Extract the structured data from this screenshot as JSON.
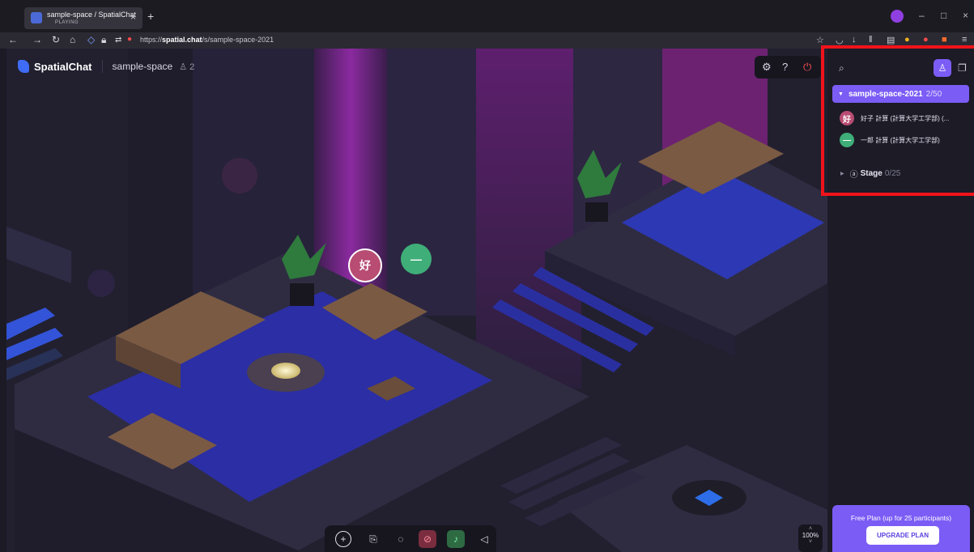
{
  "browser": {
    "tab_title": "sample-space / SpatialChat",
    "tab_status": "PLAYING",
    "url_prefix": "https://",
    "url_host": "spatial.chat",
    "url_path": "/s/sample-space-2021"
  },
  "app": {
    "brand": "SpatialChat",
    "space_name": "sample-space",
    "member_count": "2",
    "zoom": "100%"
  },
  "map_avatars": [
    {
      "initial": "好",
      "color": "#b84c72"
    },
    {
      "initial": "—",
      "color": "#3fae78"
    }
  ],
  "panel": {
    "room": {
      "name": "sample-space-2021",
      "count": "2/50"
    },
    "participants": [
      {
        "initial": "好",
        "name": "好子 計算 (計算大学工学部) (...",
        "color": "#b84c72"
      },
      {
        "initial": "—",
        "name": "一郎 計算 (計算大学工学部)",
        "color": "#3fae78"
      }
    ],
    "stage": {
      "label": "Stage",
      "count": "0/25"
    },
    "plan_text": "Free Plan (up for 25 participants)",
    "upgrade_label": "UPGRADE PLAN"
  },
  "colors": {
    "accent": "#7b5cf5",
    "highlight": "#f0131a"
  }
}
